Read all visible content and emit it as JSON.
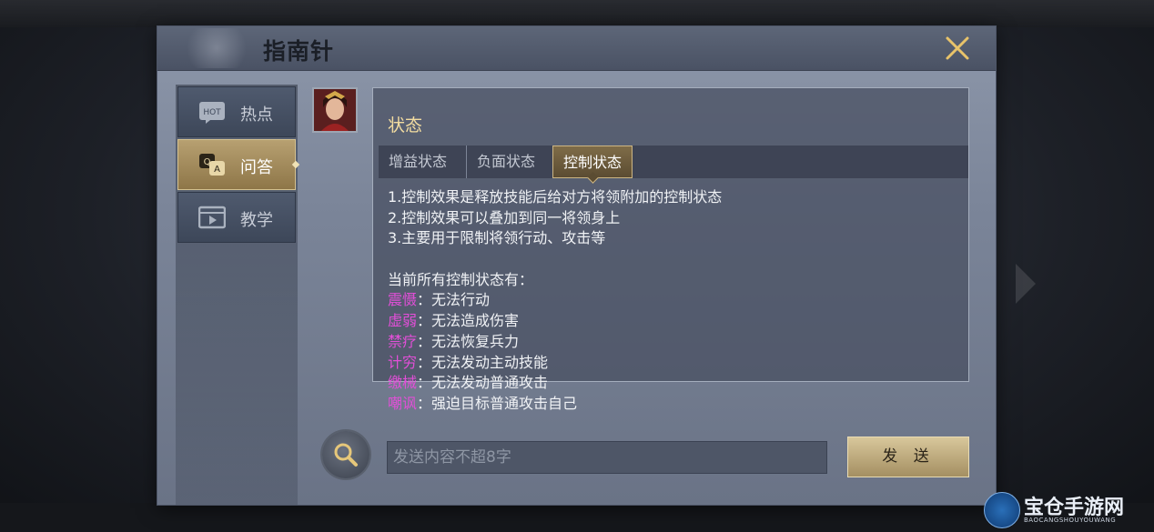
{
  "dialog": {
    "title": "指南针"
  },
  "sidebar": {
    "items": [
      {
        "label": "热点",
        "icon": "hot-icon",
        "badge": "HOT",
        "active": false
      },
      {
        "label": "问答",
        "icon": "qa-icon",
        "active": true
      },
      {
        "label": "教学",
        "icon": "video-icon",
        "active": false
      }
    ]
  },
  "panel": {
    "title": "状态",
    "tabs": [
      {
        "label": "增益状态",
        "active": false
      },
      {
        "label": "负面状态",
        "active": false
      },
      {
        "label": "控制状态",
        "active": true
      }
    ],
    "lines": [
      "1.控制效果是释放技能后给对方将领附加的控制状态",
      "2.控制效果可以叠加到同一将领身上",
      "3.主要用于限制将领行动、攻击等",
      "",
      "当前所有控制状态有："
    ],
    "states": [
      {
        "term": "震慑",
        "desc": "：无法行动"
      },
      {
        "term": "虚弱",
        "desc": "：无法造成伤害"
      },
      {
        "term": "禁疗",
        "desc": "：无法恢复兵力"
      },
      {
        "term": "计穷",
        "desc": "：无法发动主动技能"
      },
      {
        "term": "缴械",
        "desc": "：无法发动普通攻击"
      },
      {
        "term": "嘲讽",
        "desc": "：强迫目标普通攻击自己"
      }
    ]
  },
  "input": {
    "placeholder": "发送内容不超8字",
    "value": ""
  },
  "send": {
    "label": "发 送"
  },
  "watermark": {
    "title": "宝仓手游网",
    "subtitle": "BAOCANGSHOUYOUWANG"
  },
  "colors": {
    "term": "#e24fd8",
    "title": "#f2dca0",
    "active_tab": "#cdb684"
  }
}
